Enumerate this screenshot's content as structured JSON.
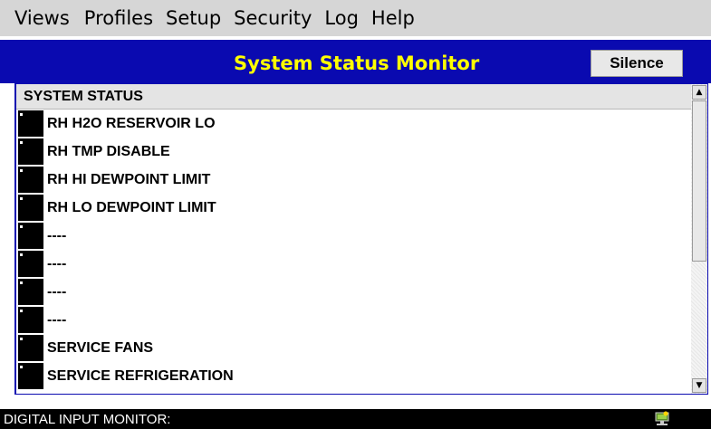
{
  "menu": [
    "Views",
    "Profiles",
    "Setup",
    "Security",
    "Log",
    "Help"
  ],
  "header": {
    "title": "System Status Monitor",
    "silence_label": "Silence"
  },
  "status_list": {
    "header": "SYSTEM STATUS",
    "items": [
      "RH H2O RESERVOIR LO",
      "RH TMP DISABLE",
      "RH HI DEWPOINT LIMIT",
      "RH LO DEWPOINT LIMIT",
      "----",
      "----",
      "----",
      "----",
      "SERVICE FANS",
      "SERVICE REFRIGERATION"
    ]
  },
  "statusbar": {
    "text": "DIGITAL INPUT MONITOR:",
    "icon": "network-tray-icon"
  },
  "colors": {
    "title_bg": "#0a0ab0",
    "title_text": "#ffff00",
    "indicator_off": "#000000"
  }
}
